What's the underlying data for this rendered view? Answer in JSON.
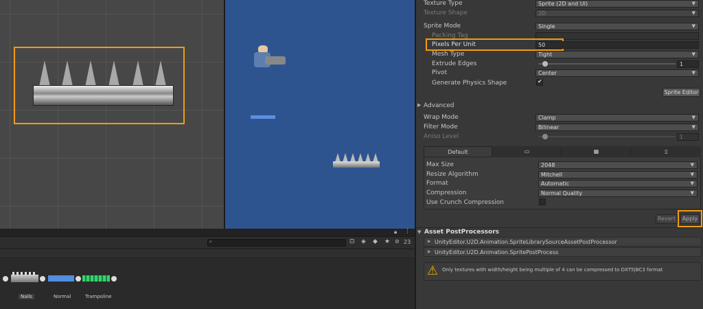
{
  "scene_view": {},
  "game_view": {},
  "bottom_panel": {
    "search_placeholder": "",
    "hidden_count": "23",
    "items": [
      {
        "label": "Nails"
      },
      {
        "label": "Normal"
      },
      {
        "label": "Trampoline"
      }
    ]
  },
  "inspector": {
    "texture_type": {
      "label": "Texture Type",
      "value": "Sprite (2D and UI)"
    },
    "texture_shape": {
      "label": "Texture Shape",
      "value": "2D"
    },
    "sprite_mode": {
      "label": "Sprite Mode",
      "value": "Single"
    },
    "packing_tag": {
      "label": "Packing Tag",
      "value": ""
    },
    "pixels_per_unit": {
      "label": "Pixels Per Unit",
      "value": "50"
    },
    "mesh_type": {
      "label": "Mesh Type",
      "value": "Tight"
    },
    "extrude_edges": {
      "label": "Extrude Edges",
      "value": "1"
    },
    "pivot": {
      "label": "Pivot",
      "value": "Center"
    },
    "generate_physics_shape": {
      "label": "Generate Physics Shape",
      "checked": true
    },
    "sprite_editor_label": "Sprite Editor",
    "advanced_label": "Advanced",
    "wrap_mode": {
      "label": "Wrap Mode",
      "value": "Clamp"
    },
    "filter_mode": {
      "label": "Filter Mode",
      "value": "Bilinear"
    },
    "aniso_level": {
      "label": "Aniso Level",
      "value": "1"
    },
    "platform_tabs": [
      {
        "label": "Default",
        "icon": ""
      },
      {
        "label": "",
        "icon": "monitor-icon"
      },
      {
        "label": "",
        "icon": "grid-icon"
      },
      {
        "label": "",
        "icon": "phone-icon"
      }
    ],
    "max_size": {
      "label": "Max Size",
      "value": "2048"
    },
    "resize_algorithm": {
      "label": "Resize Algorithm",
      "value": "Mitchell"
    },
    "format": {
      "label": "Format",
      "value": "Automatic"
    },
    "compression": {
      "label": "Compression",
      "value": "Normal Quality"
    },
    "use_crunch_compression": {
      "label": "Use Crunch Compression",
      "checked": false
    },
    "revert_label": "Revert",
    "apply_label": "Apply",
    "asset_postprocessors_label": "Asset PostProcessors",
    "postprocessors": [
      "UnityEditor.U2D.Animation.SpriteLibrarySourceAssetPostProcessor",
      "UnityEditor.U2D.Animation.SpritePostProcess"
    ],
    "warning_text": "Only textures with width/height being multiple of 4 can be compressed to DXT5|BC3 format"
  },
  "colors": {
    "highlight": "#f39c12",
    "game_bg": "#2e5490",
    "inspector_bg": "#383838"
  }
}
